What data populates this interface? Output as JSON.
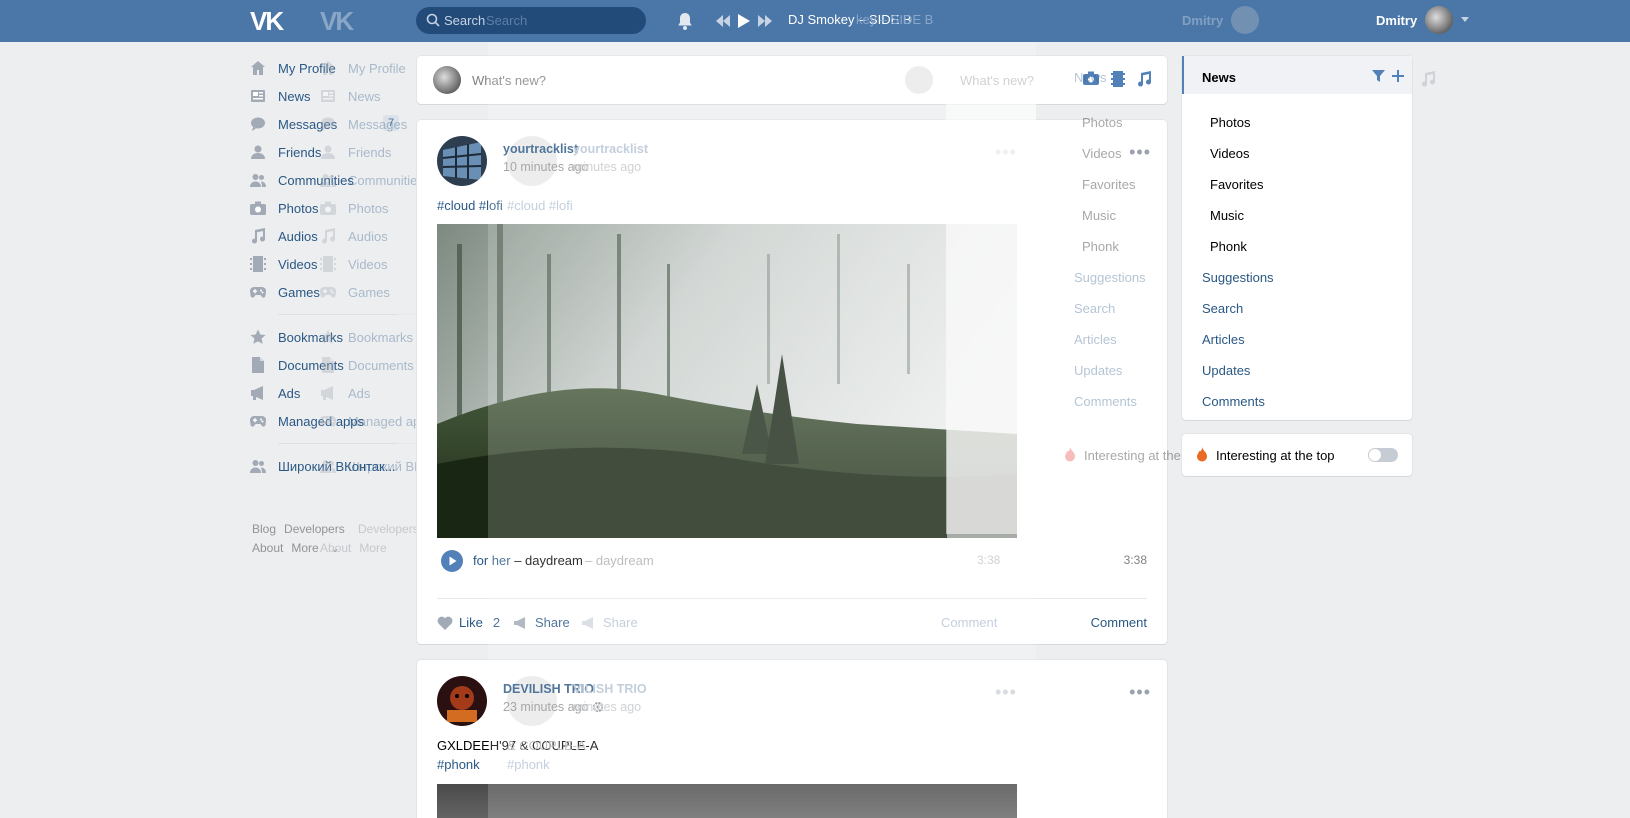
{
  "header": {
    "logo": "VK",
    "search_placeholder": "Search",
    "search_ghost": "Search",
    "now_playing": "DJ Smokey – SIDE B",
    "now_playing_ghost": "key – SIDE B",
    "user_name": "Dmitry",
    "user_name_ghost": "Dmitry"
  },
  "leftnav": {
    "items": [
      {
        "label": "My Profile",
        "icon": "home-icon"
      },
      {
        "label": "News",
        "icon": "news-icon"
      },
      {
        "label": "Messages",
        "icon": "messages-icon",
        "badge": "7"
      },
      {
        "label": "Friends",
        "icon": "friends-icon"
      },
      {
        "label": "Communities",
        "icon": "communities-icon"
      },
      {
        "label": "Photos",
        "icon": "camera-icon"
      },
      {
        "label": "Audios",
        "icon": "music-icon"
      },
      {
        "label": "Videos",
        "icon": "video-icon"
      },
      {
        "label": "Games",
        "icon": "gamepad-icon"
      }
    ],
    "items2": [
      {
        "label": "Bookmarks",
        "icon": "star-icon"
      },
      {
        "label": "Documents",
        "icon": "document-icon"
      },
      {
        "label": "Ads",
        "icon": "megaphone-icon"
      },
      {
        "label": "Managed apps",
        "icon": "gamepad-icon"
      }
    ],
    "items3": [
      {
        "label": "Широкий ВКонтак...",
        "icon": "group-icon"
      }
    ],
    "footer": {
      "blog": "Blog",
      "developers": "Developers",
      "about": "About",
      "more": "More"
    }
  },
  "composer": {
    "placeholder": "What's new?",
    "placeholder_ghost": "What's new?"
  },
  "post1": {
    "author": "yourtracklist",
    "author_ghost": "yourtracklist",
    "time": "10 minutes ago",
    "time_ghost": "minutes ago",
    "tags": "#cloud #lofi",
    "tags_ghost": "#cloud #lofi",
    "audio_artist": "for her",
    "audio_sep": " – ",
    "audio_title": "daydream",
    "audio_ghost": "– daydream",
    "duration": "3:38",
    "duration_ghost": "3:38",
    "like_label": "Like",
    "like_count": "2",
    "share_label": "Share",
    "share_ghost": "Share",
    "comment_label": "Comment",
    "comment_ghost": "Comment"
  },
  "post2": {
    "author": "DEVILISH TRIO",
    "author_ghost": "VILISH TRIO",
    "time": "23 minutes ago",
    "time_ghost": "minutes ago",
    "desc": "GXLDEEH'97 & COUPLE-A",
    "desc_ghost": "& COUPLE-A",
    "tags": "#phonk",
    "tags_ghost": "#phonk"
  },
  "rightnav": {
    "active": "News",
    "subitems": [
      "Photos",
      "Videos",
      "Favorites",
      "Music",
      "Phonk"
    ],
    "items": [
      "Suggestions",
      "Search",
      "Articles",
      "Updates",
      "Comments"
    ],
    "ghost_active": "News"
  },
  "interest": {
    "label": "Interesting at the top",
    "ghost_label": "Interesting at the to"
  }
}
